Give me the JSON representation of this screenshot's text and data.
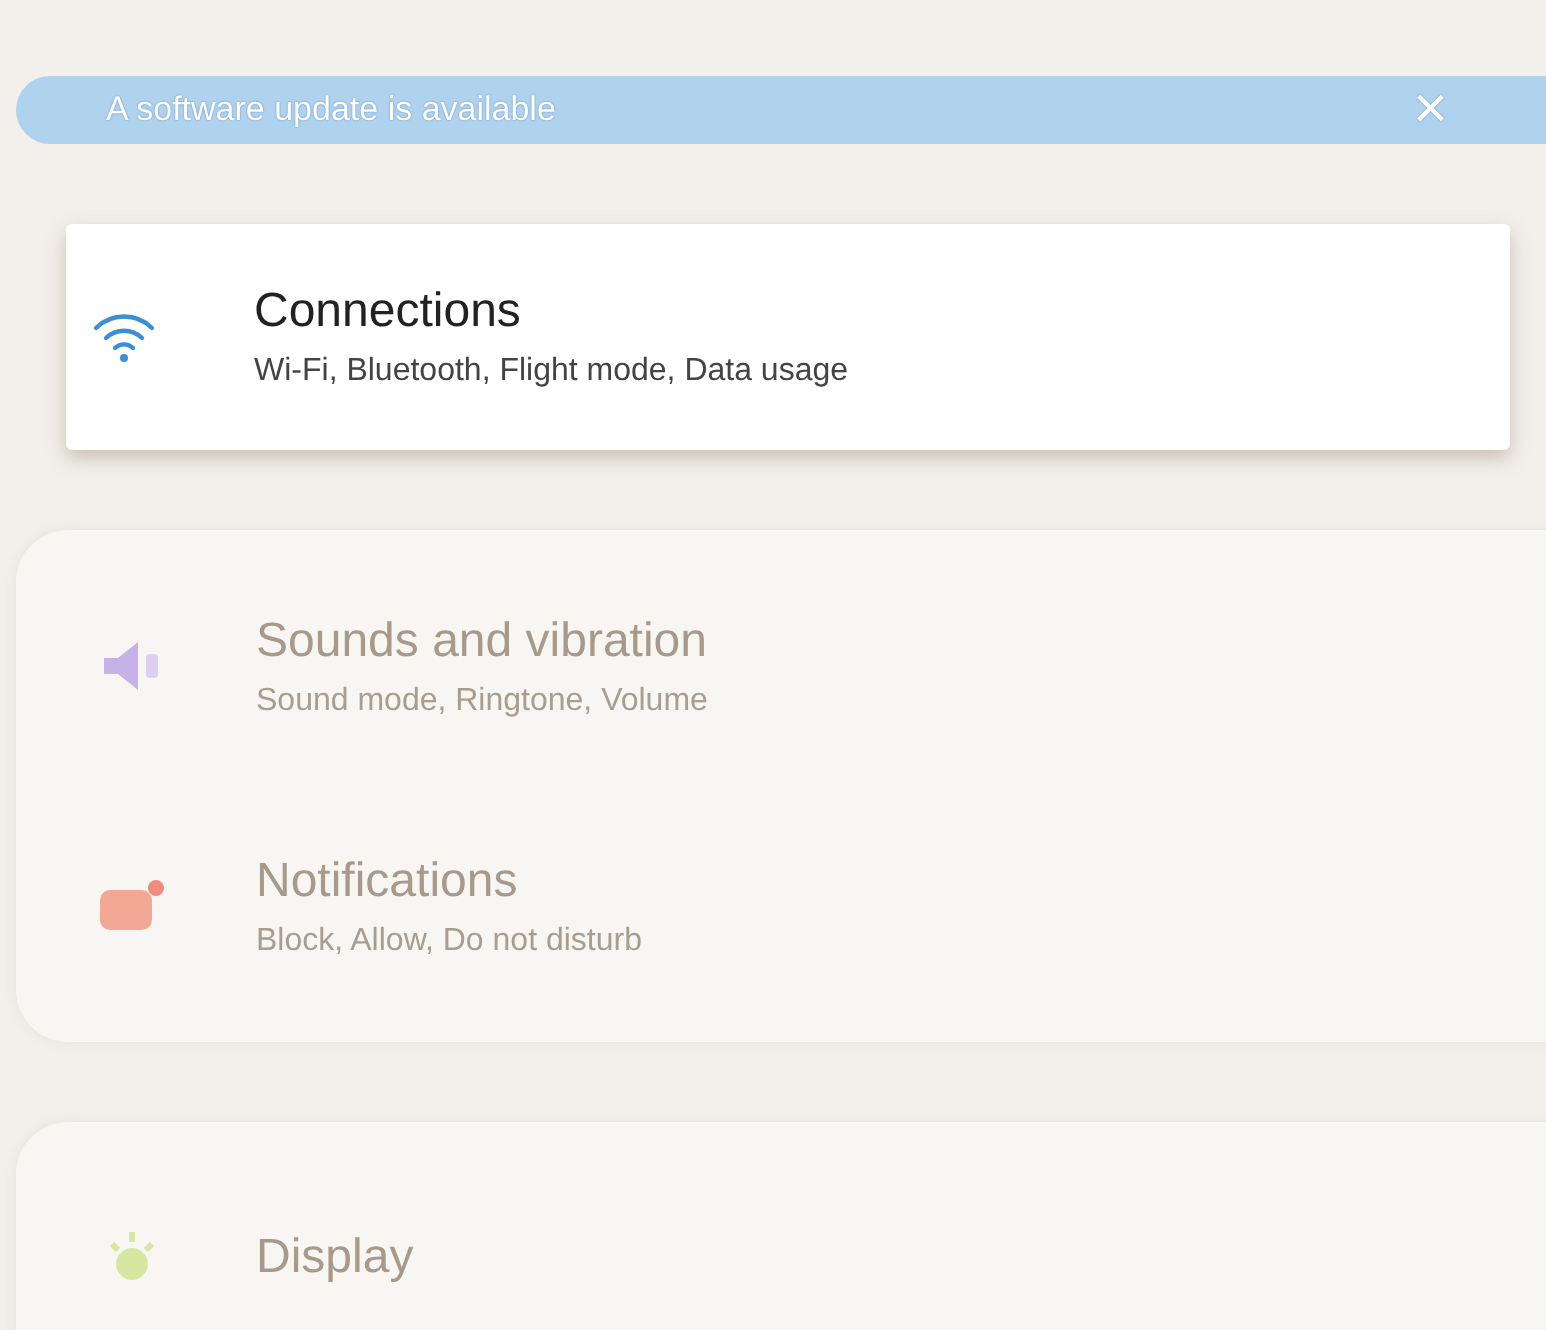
{
  "banner": {
    "text": "A software update is available",
    "close": "×"
  },
  "groups": [
    {
      "selected": true,
      "items": [
        {
          "title": "Connections",
          "subtitle": "Wi-Fi, Bluetooth, Flight mode, Data usage"
        }
      ]
    },
    {
      "selected": false,
      "items": [
        {
          "title": "Sounds and vibration",
          "subtitle": "Sound mode, Ringtone, Volume"
        },
        {
          "title": "Notifications",
          "subtitle": "Block, Allow, Do not disturb"
        }
      ]
    },
    {
      "selected": false,
      "items": [
        {
          "title": "Display"
        }
      ]
    }
  ]
}
